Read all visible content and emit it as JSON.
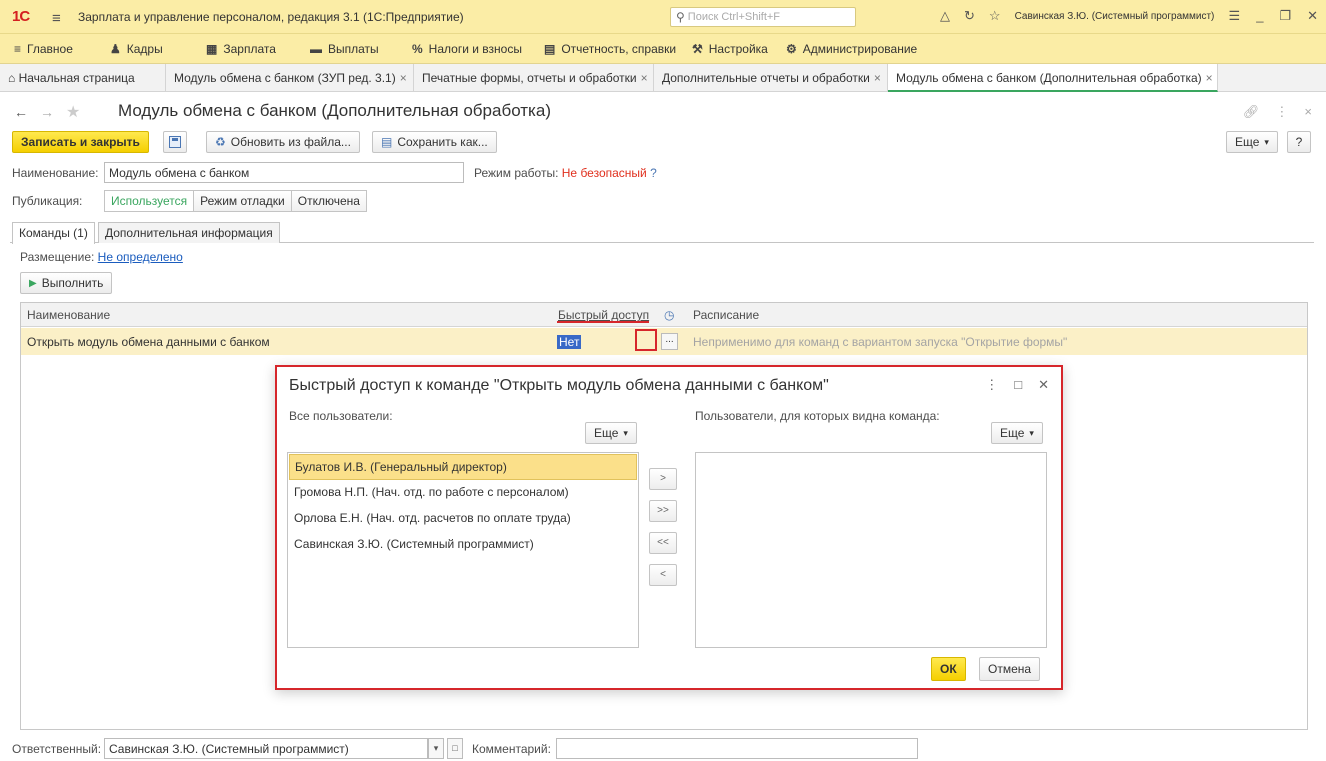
{
  "titlebar": {
    "logo": "1С",
    "title": "Зарплата и управление персоналом, редакция 3.1  (1С:Предприятие)",
    "search_placeholder": "Поиск Ctrl+Shift+F",
    "user": "Савинская З.Ю. (Системный программист)"
  },
  "sections": [
    "Главное",
    "Кадры",
    "Зарплата",
    "Выплаты",
    "Налоги и взносы",
    "Отчетность, справки",
    "Настройка",
    "Администрирование"
  ],
  "tabs": [
    {
      "label": "Начальная страница"
    },
    {
      "label": "Модуль обмена с банком (ЗУП ред. 3.1)"
    },
    {
      "label": "Печатные формы, отчеты и обработки"
    },
    {
      "label": "Дополнительные отчеты и обработки"
    },
    {
      "label": "Модуль обмена с банком (Дополнительная обработка)"
    }
  ],
  "form": {
    "title": "Модуль обмена с банком (Дополнительная обработка)",
    "save_close": "Записать и закрыть",
    "update_from_file": "Обновить из файла...",
    "save_as": "Сохранить как...",
    "more": "Еще",
    "help": "?",
    "name_label": "Наименование:",
    "name_value": "Модуль обмена с банком",
    "mode_label": "Режим работы:",
    "mode_value": "Не безопасный",
    "mode_q": "?",
    "pub_label": "Публикация:",
    "pub_options": [
      "Используется",
      "Режим отладки",
      "Отключена"
    ],
    "tab_commands": "Команды (1)",
    "tab_info": "Дополнительная информация",
    "placement_label": "Размещение:",
    "placement_value": "Не определено",
    "run": "Выполнить"
  },
  "table": {
    "col_name": "Наименование",
    "col_quick": "Быстрый доступ",
    "col_schedule": "Расписание",
    "row": {
      "name": "Открыть модуль обмена данными с банком",
      "quick": "Нет",
      "dots": "...",
      "schedule": "Неприменимо для команд с вариантом запуска \"Открытие формы\""
    }
  },
  "dialog": {
    "title": "Быстрый доступ к команде \"Открыть модуль обмена данными с банком\"",
    "all_users_label": "Все пользователи:",
    "visible_users_label": "Пользователи, для которых видна команда:",
    "more": "Еще",
    "all_users": [
      "Булатов И.В. (Генеральный директор)",
      "Громова Н.П. (Нач. отд. по работе с персоналом)",
      "Орлова Е.Н. (Нач. отд. расчетов по оплате труда)",
      "Савинская З.Ю. (Системный программист)"
    ],
    "move_buttons": [
      ">",
      ">>",
      "<<",
      "<"
    ],
    "ok": "ОК",
    "cancel": "Отмена"
  },
  "footer": {
    "resp_label": "Ответственный:",
    "resp_value": "Савинская З.Ю. (Системный программист)",
    "comment_label": "Комментарий:",
    "comment_value": ""
  }
}
